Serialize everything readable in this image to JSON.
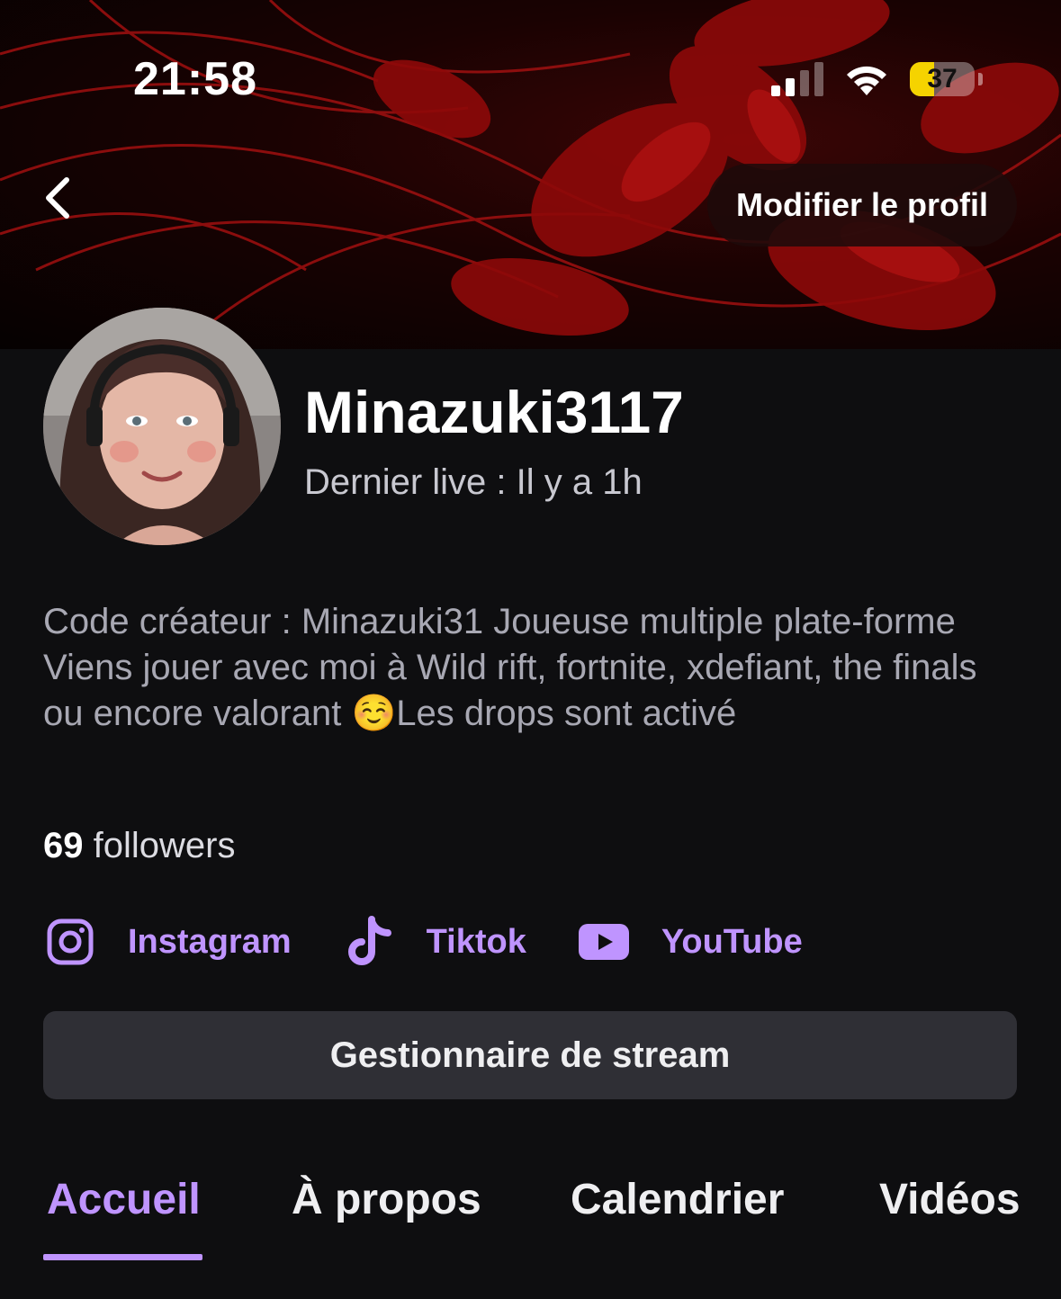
{
  "status_bar": {
    "time": "21:58",
    "battery": "37",
    "battery_level": 0.37
  },
  "header": {
    "edit_profile_label": "Modifier le profil"
  },
  "profile": {
    "username": "Minazuki3117",
    "last_live": "Dernier live : Il y a 1h",
    "bio": "Code créateur : Minazuki31 Joueuse multiple plate-forme Viens jouer avec moi à Wild rift, fortnite, xdefiant, the finals ou encore valorant ☺️Les  drops sont activé",
    "followers_count": "69",
    "followers_label": "followers"
  },
  "socials": [
    {
      "label": "Instagram",
      "icon": "instagram-icon"
    },
    {
      "label": "Tiktok",
      "icon": "tiktok-icon"
    },
    {
      "label": "YouTube",
      "icon": "youtube-icon"
    }
  ],
  "stream_manager_label": "Gestionnaire de stream",
  "tabs": [
    {
      "label": "Accueil",
      "active": true
    },
    {
      "label": "À propos",
      "active": false
    },
    {
      "label": "Calendrier",
      "active": false
    },
    {
      "label": "Vidéos",
      "active": false
    }
  ],
  "colors": {
    "accent": "#bf94ff",
    "background": "#0e0e10",
    "button": "#2f2f35"
  }
}
